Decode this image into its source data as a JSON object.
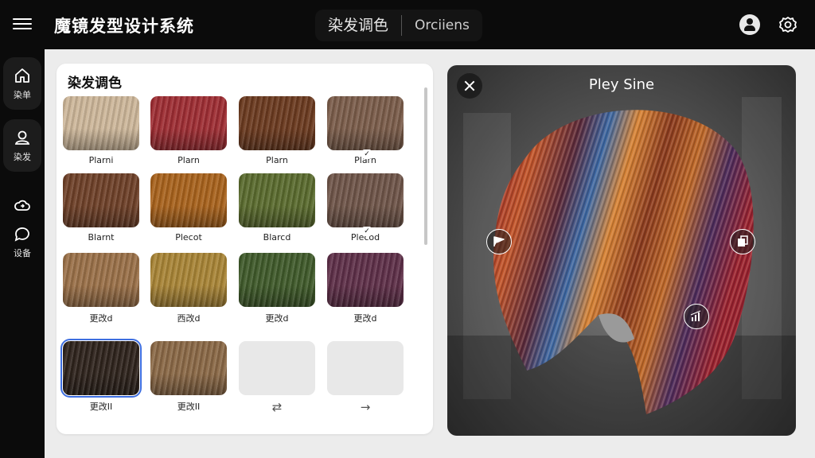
{
  "header": {
    "app_title": "魔镜发型设计系统",
    "tabs": [
      {
        "label": "染发调色",
        "active": true
      },
      {
        "label": "Orciiens",
        "active": false
      }
    ],
    "icons": [
      "menu-icon",
      "user-icon",
      "gear-icon"
    ]
  },
  "sidebar": {
    "items": [
      {
        "label": "染单",
        "icon": "home-icon",
        "active": true
      },
      {
        "label": "染发",
        "icon": "person-icon",
        "active": true
      },
      {
        "label": "",
        "icon": "cloud-icon",
        "active": false
      },
      {
        "label": "设备",
        "icon": "chat-icon",
        "active": false
      }
    ]
  },
  "palette": {
    "title": "染发调色",
    "swatches": [
      {
        "label": "Plarni",
        "color": "#cdb79a"
      },
      {
        "label": "Plarn",
        "color": "#9e2d33"
      },
      {
        "label": "Plarn",
        "color": "#6b3a1f"
      },
      {
        "label": "Plarn",
        "color": "#7a5c4a",
        "badge": true
      },
      {
        "label": "Blarnt",
        "color": "#6e4028"
      },
      {
        "label": "Plecot",
        "color": "#a8621c"
      },
      {
        "label": "Blarcd",
        "color": "#5a6b2e"
      },
      {
        "label": "Plecod",
        "color": "#6e5448",
        "badge": true
      },
      {
        "label": "更改d",
        "color": "#9a7048"
      },
      {
        "label": "西改d",
        "color": "#a88436"
      },
      {
        "label": "更改d",
        "color": "#3f5a2a"
      },
      {
        "label": "更改d",
        "color": "#5e2f48"
      },
      {
        "label": "更改II",
        "color": "#2e231c",
        "selected": true
      },
      {
        "label": "更改II",
        "color": "#8a6846"
      },
      {
        "label": "",
        "color": "",
        "empty": true,
        "icon": "shuffle-icon"
      },
      {
        "label": "",
        "color": "",
        "empty": true,
        "icon": "arrow-right-icon"
      }
    ]
  },
  "preview": {
    "title": "Pley Sine",
    "icons": [
      "close-icon",
      "flag-icon",
      "copy-icon",
      "bars-icon"
    ]
  },
  "colors": {
    "topbar": "#0b0b0b",
    "selected_outline": "#3d6ee0",
    "panel_bg": "#ffffff"
  }
}
